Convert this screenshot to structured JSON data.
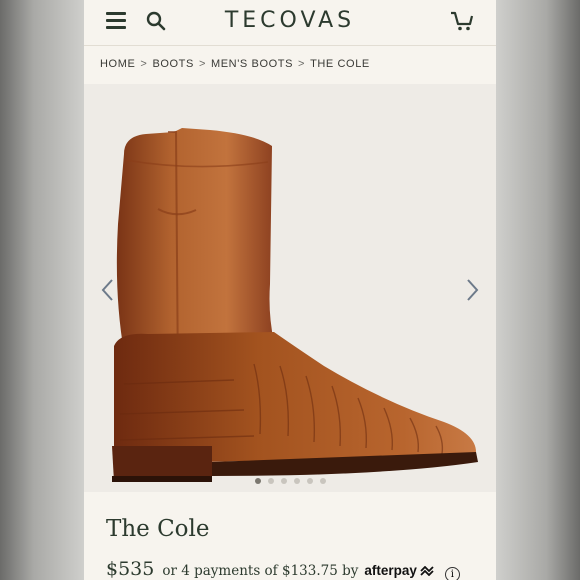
{
  "header": {
    "brand": "TECOVAS",
    "icons": [
      "menu-icon",
      "search-icon",
      "cart-icon"
    ]
  },
  "breadcrumb": [
    {
      "label": "HOME"
    },
    {
      "label": "BOOTS"
    },
    {
      "label": "MEN'S BOOTS"
    },
    {
      "label": "THE COLE"
    }
  ],
  "breadcrumb_separator": ">",
  "gallery": {
    "image_alt": "boot-photo",
    "dot_count": 6,
    "active_dot": 0
  },
  "product": {
    "title": "The Cole",
    "price": "$535",
    "installment_text": "or 4 payments of $133.75 by",
    "provider": "afterpay",
    "info_glyph": "i"
  },
  "colors": {
    "brand_green": "#2c3a2e",
    "leather": "#a5552a",
    "background": "#f7f4ee"
  }
}
